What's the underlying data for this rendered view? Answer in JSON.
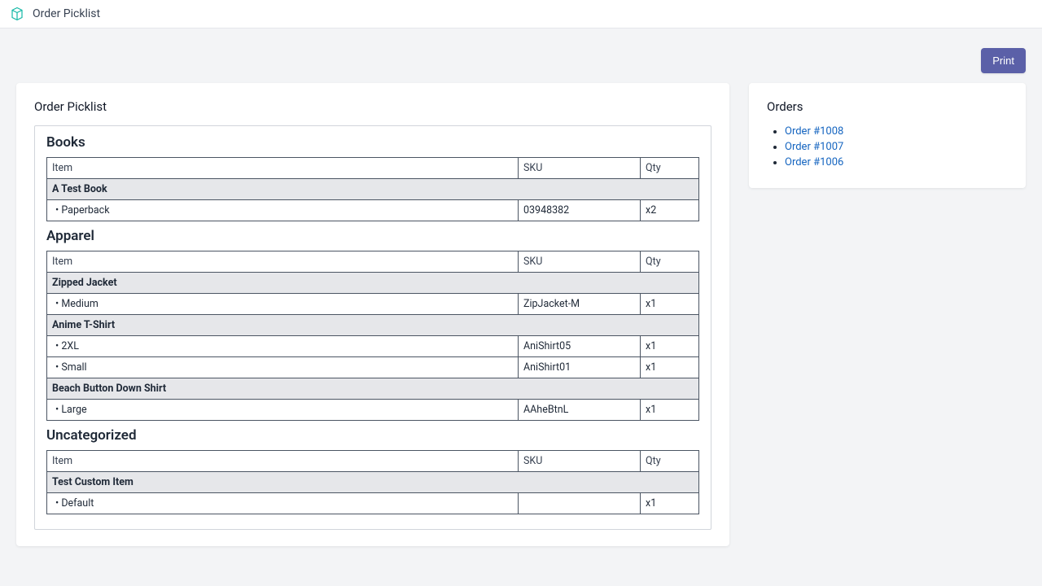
{
  "topbar": {
    "title": "Order Picklist"
  },
  "actions": {
    "print_label": "Print"
  },
  "picklist": {
    "title": "Order Picklist",
    "headers": {
      "item": "Item",
      "sku": "SKU",
      "qty": "Qty"
    },
    "categories": [
      {
        "name": "Books",
        "groups": [
          {
            "product": "A Test Book",
            "rows": [
              {
                "variant": "Paperback",
                "sku": "03948382",
                "qty": "x2"
              }
            ]
          }
        ]
      },
      {
        "name": "Apparel",
        "groups": [
          {
            "product": "Zipped Jacket",
            "rows": [
              {
                "variant": "Medium",
                "sku": "ZipJacket-M",
                "qty": "x1"
              }
            ]
          },
          {
            "product": "Anime T-Shirt",
            "rows": [
              {
                "variant": "2XL",
                "sku": "AniShirt05",
                "qty": "x1"
              },
              {
                "variant": "Small",
                "sku": "AniShirt01",
                "qty": "x1"
              }
            ]
          },
          {
            "product": "Beach Button Down Shirt",
            "rows": [
              {
                "variant": "Large",
                "sku": "AAheBtnL",
                "qty": "x1"
              }
            ]
          }
        ]
      },
      {
        "name": "Uncategorized",
        "groups": [
          {
            "product": "Test Custom Item",
            "rows": [
              {
                "variant": "Default",
                "sku": "",
                "qty": "x1"
              }
            ]
          }
        ]
      }
    ]
  },
  "orders": {
    "title": "Orders",
    "items": [
      {
        "label": "Order #1008"
      },
      {
        "label": "Order #1007"
      },
      {
        "label": "Order #1006"
      }
    ]
  }
}
